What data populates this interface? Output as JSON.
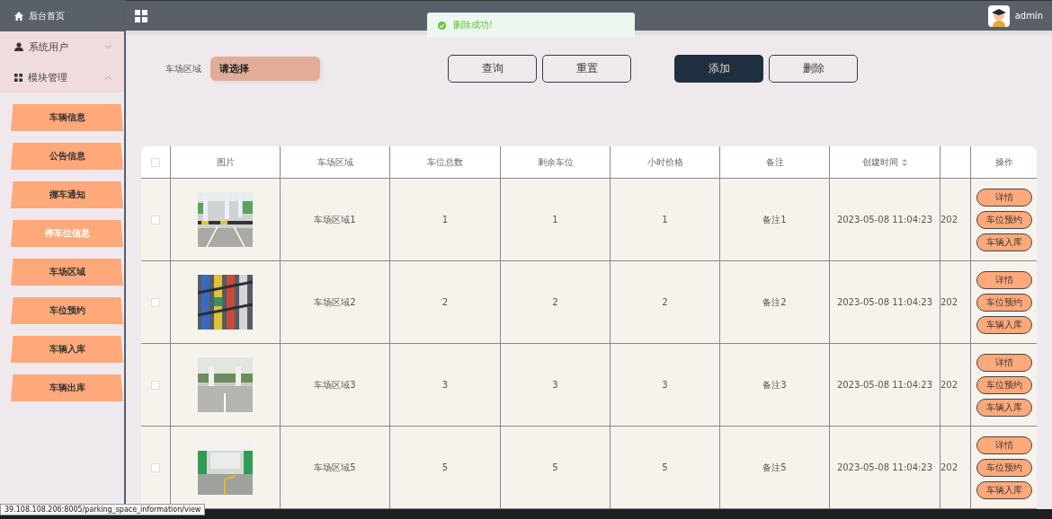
{
  "sidebar": {
    "home": "后台首页",
    "groups": [
      {
        "label": "系统用户",
        "expanded": false
      },
      {
        "label": "模块管理",
        "expanded": true,
        "children": [
          {
            "label": "车辆信息",
            "selected": false
          },
          {
            "label": "公告信息",
            "selected": false
          },
          {
            "label": "挪车通知",
            "selected": false
          },
          {
            "label": "停车位信息",
            "selected": true
          },
          {
            "label": "车场区域",
            "selected": false
          },
          {
            "label": "车位预约",
            "selected": false
          },
          {
            "label": "车辆入库",
            "selected": false
          },
          {
            "label": "车辆出库",
            "selected": false
          }
        ]
      }
    ]
  },
  "header": {
    "user": "admin"
  },
  "toast": {
    "message": "删除成功!"
  },
  "filter": {
    "label": "车场区域",
    "placeholder": "请选择"
  },
  "buttons": [
    {
      "label": "查询",
      "kind": "outline"
    },
    {
      "label": "重置",
      "kind": "outline"
    },
    {
      "label": "添加",
      "kind": "primary"
    },
    {
      "label": "删除",
      "kind": "outline"
    }
  ],
  "table": {
    "select_all_checked": false,
    "columns": [
      {
        "label": "图片",
        "sortable": false
      },
      {
        "label": "车场区域",
        "sortable": false
      },
      {
        "label": "车位总数",
        "sortable": false
      },
      {
        "label": "剩余车位",
        "sortable": false
      },
      {
        "label": "小时价格",
        "sortable": false
      },
      {
        "label": "备注",
        "sortable": false
      },
      {
        "label": "创建时间",
        "sortable": true
      }
    ],
    "actions_column": "操作",
    "rows": [
      {
        "checked": false,
        "area": "车场区域1",
        "total": "1",
        "remaining": "1",
        "price": "1",
        "note": "备注1",
        "created": "2023-05-08 11:04:23",
        "column_9": "202",
        "actions": [
          "详情",
          "车位预约",
          "车辆入库"
        ]
      },
      {
        "checked": false,
        "area": "车场区域2",
        "total": "2",
        "remaining": "2",
        "price": "2",
        "note": "备注2",
        "created": "2023-05-08 11:04:23",
        "column_9": "202",
        "actions": [
          "详情",
          "车位预约",
          "车辆入库"
        ]
      },
      {
        "checked": false,
        "area": "车场区域3",
        "total": "3",
        "remaining": "3",
        "price": "3",
        "note": "备注3",
        "created": "2023-05-08 11:04:23",
        "column_9": "202",
        "actions": [
          "详情",
          "车位预约",
          "车辆入库"
        ]
      },
      {
        "checked": false,
        "area": "车场区域5",
        "total": "5",
        "remaining": "5",
        "price": "5",
        "note": "备注5",
        "created": "2023-05-08 11:04:23",
        "column_9": "202",
        "actions": [
          "详情",
          "车位预约",
          "车辆入库"
        ]
      }
    ]
  },
  "status_bar": "39.108.108.206:8005/parking_space_information/view"
}
